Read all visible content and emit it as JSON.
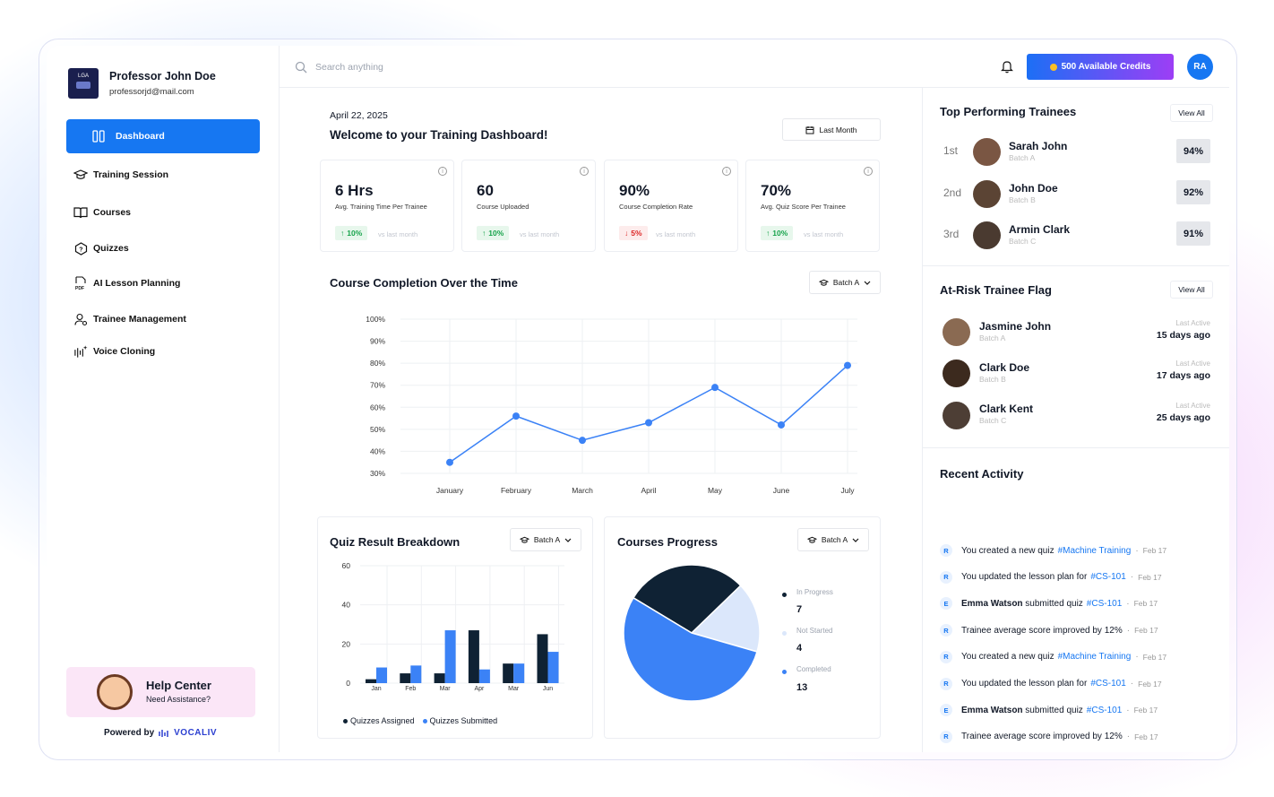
{
  "profile": {
    "name": "Professor John Doe",
    "email": "professorjd@mail.com",
    "logo_text": "LGA"
  },
  "nav": [
    {
      "label": "Dashboard",
      "icon": "dashboard-icon",
      "active": true
    },
    {
      "label": "Training Session",
      "icon": "graduation-cap-icon"
    },
    {
      "label": "Courses",
      "icon": "book-icon"
    },
    {
      "label": "Quizzes",
      "icon": "question-icon"
    },
    {
      "label": "AI Lesson Planning",
      "icon": "pdf-icon"
    },
    {
      "label": "Trainee Management",
      "icon": "user-settings-icon"
    },
    {
      "label": "Voice Cloning",
      "icon": "waveform-icon"
    }
  ],
  "help": {
    "title": "Help Center",
    "subtitle": "Need Assistance?"
  },
  "powered": {
    "label": "Powered by",
    "brand": "VOCALIV"
  },
  "topbar": {
    "search_placeholder": "Search anything",
    "credits": "500 Available Credits",
    "user_initials": "RA"
  },
  "header": {
    "date": "April 22, 2025",
    "welcome": "Welcome to your Training Dashboard!",
    "filter": "Last Month"
  },
  "kpis": [
    {
      "value": "6 Hrs",
      "label": "Avg. Training Time Per Trainee",
      "change": "10%",
      "trend": "up",
      "compare": "vs last month"
    },
    {
      "value": "60",
      "label": "Course Uploaded",
      "change": "10%",
      "trend": "up",
      "compare": "vs last month"
    },
    {
      "value": "90%",
      "label": "Course Completion Rate",
      "change": "5%",
      "trend": "down",
      "compare": "vs last month"
    },
    {
      "value": "70%",
      "label": "Avg. Quiz Score Per Trainee",
      "change": "10%",
      "trend": "up",
      "compare": "vs last month"
    }
  ],
  "completion": {
    "title": "Course Completion Over the Time",
    "batch": "Batch A"
  },
  "quiz": {
    "title": "Quiz Result Breakdown",
    "batch": "Batch A",
    "legend_assigned": "Quizzes Assigned",
    "legend_submitted": "Quizzes Submitted"
  },
  "progress": {
    "title": "Courses Progress",
    "batch": "Batch A",
    "items": [
      {
        "label": "In Progress",
        "value": "7"
      },
      {
        "label": "Not Started",
        "value": "4"
      },
      {
        "label": "Completed",
        "value": "13"
      }
    ]
  },
  "chart_data": [
    {
      "type": "line",
      "title": "Course Completion Over the Time",
      "categories": [
        "January",
        "February",
        "March",
        "April",
        "May",
        "June",
        "July"
      ],
      "values": [
        35,
        56,
        45,
        53,
        69,
        52,
        79
      ],
      "y_ticks": [
        "100%",
        "90%",
        "80%",
        "70%",
        "60%",
        "50%",
        "40%",
        "30%"
      ],
      "ylim": [
        30,
        100
      ],
      "color": "#3b82f6",
      "grid": true
    },
    {
      "type": "bar",
      "title": "Quiz Result Breakdown",
      "categories": [
        "Jan",
        "Feb",
        "Mar",
        "Apr",
        "Mar",
        "Jun"
      ],
      "series": [
        {
          "name": "Quizzes Assigned",
          "values": [
            2,
            5,
            5,
            27,
            10,
            25
          ],
          "color": "#0f2234"
        },
        {
          "name": "Quizzes Submitted",
          "values": [
            8,
            9,
            27,
            7,
            10,
            16
          ],
          "color": "#3b82f6"
        }
      ],
      "y_ticks": [
        "60",
        "40",
        "20",
        "0"
      ],
      "ylim": [
        0,
        60
      ],
      "grid": true
    },
    {
      "type": "pie",
      "title": "Courses Progress",
      "labels": [
        "In Progress",
        "Not Started",
        "Completed"
      ],
      "values": [
        7,
        4,
        13
      ],
      "colors": [
        "#0f2234",
        "#dbe7fb",
        "#3b82f6"
      ]
    }
  ],
  "top_trainees": {
    "title": "Top Performing Trainees",
    "view_all": "View All",
    "items": [
      {
        "rank": "1st",
        "name": "Sarah John",
        "batch": "Batch A",
        "score": "94%"
      },
      {
        "rank": "2nd",
        "name": "John Doe",
        "batch": "Batch B",
        "score": "92%"
      },
      {
        "rank": "3rd",
        "name": "Armin Clark",
        "batch": "Batch C",
        "score": "91%"
      }
    ]
  },
  "at_risk": {
    "title": "At-Risk Trainee Flag",
    "view_all": "View All",
    "items": [
      {
        "name": "Jasmine John",
        "batch": "Batch A",
        "label": "Last Active",
        "value": "15 days ago"
      },
      {
        "name": "Clark Doe",
        "batch": "Batch B",
        "label": "Last Active",
        "value": "17 days ago"
      },
      {
        "name": "Clark Kent",
        "batch": "Batch C",
        "label": "Last Active",
        "value": "25 days ago"
      }
    ]
  },
  "activity": {
    "title": "Recent Activity",
    "items": [
      {
        "badge": "R",
        "pre": "",
        "bold": "",
        "text": "You created a new quiz",
        "tag": "#Machine Training",
        "date": "Feb 17"
      },
      {
        "badge": "R",
        "pre": "",
        "bold": "",
        "text": "You updated the lesson plan for",
        "tag": "#CS-101",
        "date": "Feb 17"
      },
      {
        "badge": "E",
        "pre": "",
        "bold": "Emma Watson",
        "text": " submitted quiz",
        "tag": "#CS-101",
        "date": "Feb 17"
      },
      {
        "badge": "R",
        "pre": "",
        "bold": "",
        "text": "Trainee average score improved by 12%",
        "tag": "",
        "date": "Feb 17"
      },
      {
        "badge": "R",
        "pre": "",
        "bold": "",
        "text": "You created a new quiz",
        "tag": "#Machine Training",
        "date": "Feb 17"
      },
      {
        "badge": "R",
        "pre": "",
        "bold": "",
        "text": "You updated the lesson plan for",
        "tag": "#CS-101",
        "date": "Feb 17"
      },
      {
        "badge": "E",
        "pre": "",
        "bold": "Emma Watson",
        "text": " submitted quiz",
        "tag": "#CS-101",
        "date": "Feb 17"
      },
      {
        "badge": "R",
        "pre": "",
        "bold": "",
        "text": "Trainee average score improved by 12%",
        "tag": "",
        "date": "Feb 17"
      }
    ]
  }
}
